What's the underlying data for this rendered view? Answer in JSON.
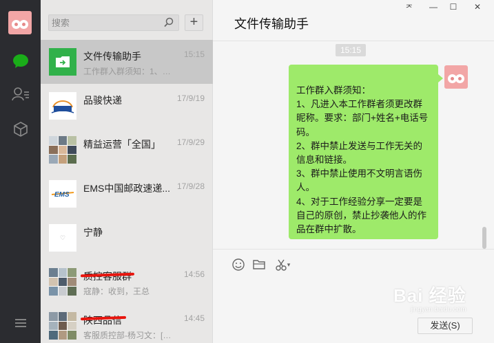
{
  "rail": {
    "icons": [
      "user-avatar",
      "chat-bubble-icon",
      "contacts-icon",
      "cube-icon",
      "menu-icon"
    ]
  },
  "search": {
    "placeholder": "搜索"
  },
  "add_label": "+",
  "chats": [
    {
      "name": "文件传输助手",
      "preview": "工作群入群须知：1、凡...",
      "time": "15:15",
      "active": true
    },
    {
      "name": "品骏快递",
      "preview": "",
      "time": "17/9/19"
    },
    {
      "name": "精益运营「全国」",
      "preview": "",
      "time": "17/9/29"
    },
    {
      "name": "EMS中国邮政速递...",
      "preview": "",
      "time": "17/9/28"
    },
    {
      "name": "宁静",
      "preview": "",
      "time": ""
    },
    {
      "name": "质控客服群",
      "preview": "寇静：收到，王总",
      "time": "14:56"
    },
    {
      "name": "陕西品信",
      "preview": "客服质控部-杨习文：[文...",
      "time": "14:45"
    }
  ],
  "window": {
    "title": "文件传输助手",
    "pin": "ᅎ",
    "minimize": "—",
    "maximize": "☐",
    "close": "✕"
  },
  "message": {
    "timestamp": "15:15",
    "lines": [
      "工作群入群须知：",
      "1、凡进入本工作群者须更改群昵称。要求：部门+姓名+电话号码。",
      "2、群中禁止发送与工作无关的信息和链接。",
      "3、群中禁止使用不文明言语伤人。",
      "4、对于工作经验分享一定要是自己的原创，禁止抄袭他人的作品在群中扩散。"
    ]
  },
  "toolbar": {
    "icons": [
      "emoji-icon",
      "folder-icon",
      "scissors-icon"
    ],
    "dropdown": "▾"
  },
  "send_label": "发送(S)",
  "watermark": {
    "main": "Bai 经验",
    "sub": "jingyan.baidu.com"
  },
  "colors": {
    "bubble": "#9eea6a",
    "rail": "#2b2c30",
    "accent_green": "#1aad19",
    "strike": "#e8150e"
  }
}
